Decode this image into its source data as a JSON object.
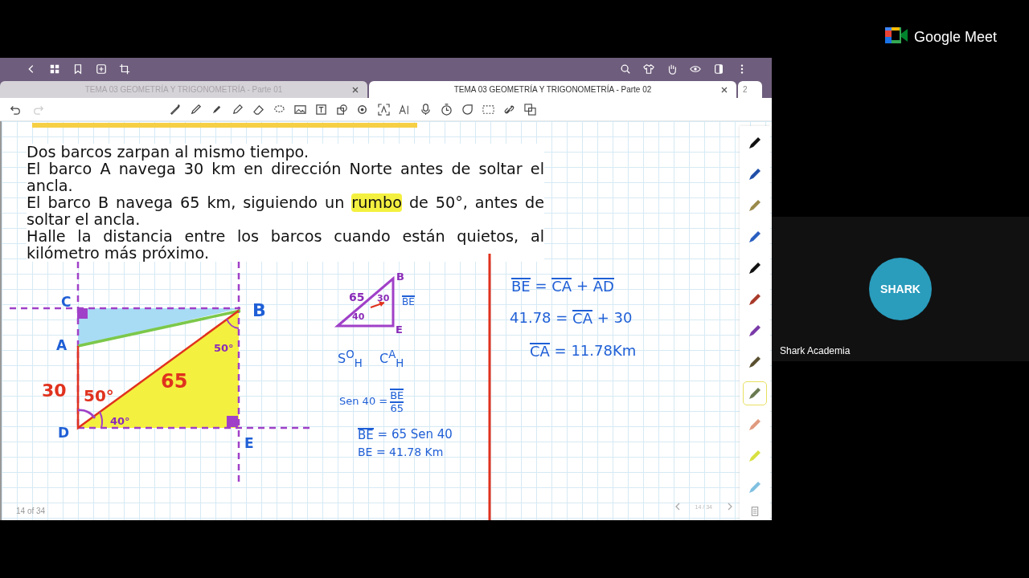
{
  "meet": {
    "brand": "Google Meet",
    "participant": {
      "name": "Shark Academia",
      "avatar_text": "SHARK"
    }
  },
  "tabs": [
    {
      "label": "TEMA 03 GEOMETRÍA Y TRIGONOMETRÍA - Parte 01",
      "selected": false
    },
    {
      "label": "TEMA 03 GEOMETRÍA Y TRIGONOMETRÍA - Parte 02",
      "selected": true
    }
  ],
  "tab_overflow": "2",
  "problem": [
    [
      {
        "text": "Dos barcos zarpan al mismo tiempo.",
        "highlighted": false
      }
    ],
    [
      {
        "text": "El barco A navega 30 km en dirección Norte antes de soltar el ancla.",
        "highlighted": false
      }
    ],
    [
      {
        "text": "El barco B navega 65 km, siguiendo un ",
        "highlighted": false
      },
      {
        "text": "rumbo",
        "highlighted": true
      },
      {
        "text": " de 50°, antes de soltar el ancla.",
        "highlighted": false
      }
    ],
    [
      {
        "text": "Halle la distancia entre los barcos cuando están quietos, al kilómetro más próximo.",
        "highlighted": false
      }
    ]
  ],
  "diagram_labels": [
    {
      "text": "C",
      "color": "#1f5fd6"
    },
    {
      "text": "A",
      "color": "#1f5fd6"
    },
    {
      "text": "B",
      "color": "#1f5fd6"
    },
    {
      "text": "D",
      "color": "#1f5fd6"
    },
    {
      "text": "E",
      "color": "#1f5fd6"
    },
    {
      "text": "30",
      "color": "#e0321e"
    },
    {
      "text": "50°",
      "color": "#e0321e"
    },
    {
      "text": "65",
      "color": "#e0321e"
    },
    {
      "text": "40°",
      "color": "#8a2bb8"
    },
    {
      "text": "50°",
      "color": "#8a2bb8"
    },
    {
      "text": "B",
      "color": "#8a2bb8"
    },
    {
      "text": "E",
      "color": "#8a2bb8"
    },
    {
      "text": "65",
      "color": "#8a2bb8"
    },
    {
      "text": "30",
      "color": "#8a2bb8"
    },
    {
      "text": "40",
      "color": "#8a2bb8"
    }
  ],
  "equations": [
    [
      {
        "text": "BE",
        "overline": true
      }
    ],
    [
      {
        "text": "S$^{O}$$_{H}$",
        "overline": false
      }
    ],
    [
      {
        "text": "C$^{A}$$_{H}$",
        "overline": false
      }
    ],
    [
      {
        "text": "Sen 40 =",
        "overline": false
      },
      {
        "kind": "fraction",
        "num": "BE",
        "den": "65"
      }
    ],
    [
      {
        "text": "BE",
        "overline": true
      },
      {
        "text": " = 65 Sen 40",
        "overline": false
      }
    ],
    [
      {
        "text": "BE = 41.78 Km",
        "overline": false
      }
    ],
    [
      {
        "text": "BE",
        "overline": true
      },
      {
        "text": " = ",
        "overline": false
      },
      {
        "text": "CA",
        "overline": true
      },
      {
        "text": " + ",
        "overline": false
      },
      {
        "text": "AD",
        "overline": true
      }
    ],
    [
      {
        "text": "41.78 = ",
        "overline": false
      },
      {
        "text": "CA",
        "overline": true
      },
      {
        "text": " + 30",
        "overline": false
      }
    ],
    [
      {
        "text": "CA",
        "overline": true
      },
      {
        "text": " = 11.78Km",
        "overline": false
      }
    ]
  ],
  "pens": [
    {
      "color": "#111111",
      "selected": false
    },
    {
      "color": "#1f4fa8",
      "selected": false
    },
    {
      "color": "#9a8a4a",
      "selected": false
    },
    {
      "color": "#2a5fc0",
      "selected": false
    },
    {
      "color": "#111111",
      "selected": false
    },
    {
      "color": "#a83a2a",
      "selected": false
    },
    {
      "color": "#7a3aa8",
      "selected": false
    },
    {
      "color": "#5a5030",
      "selected": false
    },
    {
      "color": "#6a7a50",
      "selected": true
    },
    {
      "color": "#e09a80",
      "selected": false
    },
    {
      "color": "#d8e040",
      "selected": false
    },
    {
      "color": "#80c0e0",
      "selected": false
    }
  ],
  "page_indicator": "14 of 34",
  "page_nav": "14 / 34"
}
